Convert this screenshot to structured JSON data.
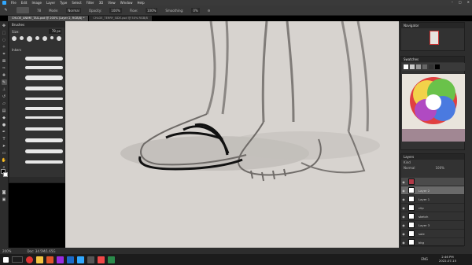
{
  "menubar": {
    "items": [
      "File",
      "Edit",
      "Image",
      "Layer",
      "Type",
      "Select",
      "Filter",
      "3D",
      "View",
      "Window",
      "Help"
    ],
    "window_controls": [
      "–",
      "□",
      "✕"
    ]
  },
  "optionsbar": {
    "brush_size": "78",
    "mode_label": "Mode:",
    "mode_value": "Normal",
    "opacity_label": "Opacity:",
    "opacity_value": "100%",
    "flow_label": "Flow:",
    "flow_value": "100%",
    "smoothing_label": "Smoothing:",
    "smoothing_value": "0%"
  },
  "tabs": [
    {
      "label": "CHLOE_ANIME_TAIL.psd @ 200% (Layer 2, RGB/8) *",
      "active": true
    },
    {
      "label": "CHLOE_TERRY_SIDE.psd @ 50% RGB/8",
      "active": false
    }
  ],
  "brushes_panel": {
    "title": "Brushes",
    "size_label": "Size:",
    "size_value": "78 px",
    "group_label": "Inkers"
  },
  "layers_panel": {
    "title": "Layers",
    "kind_label": "Kind",
    "blend_mode": "Normal",
    "opacity": "100%",
    "layers": [
      {
        "name": "",
        "thumb": "#b23a48",
        "state": "sel"
      },
      {
        "name": "Layer 2",
        "thumb": "#ffffff",
        "state": "active"
      },
      {
        "name": "Layer 1",
        "thumb": "#ffffff",
        "state": "normal"
      },
      {
        "name": "clip",
        "thumb": "#ffffff",
        "state": "normal"
      },
      {
        "name": "sketch",
        "thumb": "#ffffff",
        "state": "normal"
      },
      {
        "name": "Layer 3",
        "thumb": "#ffffff",
        "state": "normal"
      },
      {
        "name": "sole",
        "thumb": "#ffffff",
        "state": "normal"
      },
      {
        "name": "bkg",
        "thumb": "#ffffff",
        "state": "normal"
      }
    ]
  },
  "navigator_title": "Navigator",
  "swatches_title": "Swatches",
  "status": {
    "zoom": "200%",
    "doc": "Doc: 34.5M/1.65G"
  },
  "clock": {
    "time": "2:46 PM",
    "date": "2022-07-15"
  },
  "tray_lang": "ENG",
  "colors": {
    "canvas": "#d7d3cf",
    "ink": "#111111",
    "accent": "#31a8ff"
  },
  "icons": [
    "photoshop-logo-icon",
    "brush-icon",
    "move-icon",
    "lasso-icon",
    "crop-icon",
    "eyedropper-icon",
    "eraser-icon",
    "type-icon",
    "hand-icon",
    "zoom-icon",
    "windows-start-icon",
    "chrome-icon",
    "explorer-icon"
  ]
}
